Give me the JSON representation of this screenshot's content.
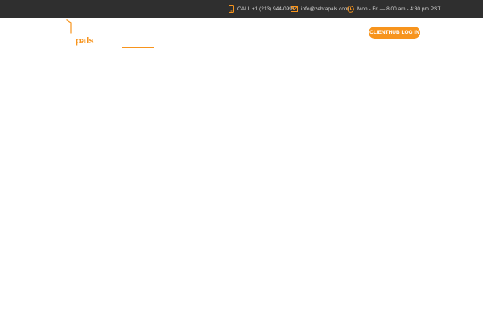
{
  "topbar": {
    "phone": {
      "icon": "phone-icon",
      "text": "CALL +1 (213) 944-0991"
    },
    "email": {
      "icon": "mail-icon",
      "text": "info@zebrapals.com"
    },
    "hours": {
      "icon": "clock-icon",
      "text": "Mon - Fri — 8:00 am - 4:30 pm PST"
    },
    "background": "#2f2f2f"
  },
  "header": {
    "logo_text": "pals",
    "cta_label": "CLIENTHUB LOG IN"
  },
  "colors": {
    "accent": "#f7941d",
    "topbar": "#2f2f2f"
  }
}
